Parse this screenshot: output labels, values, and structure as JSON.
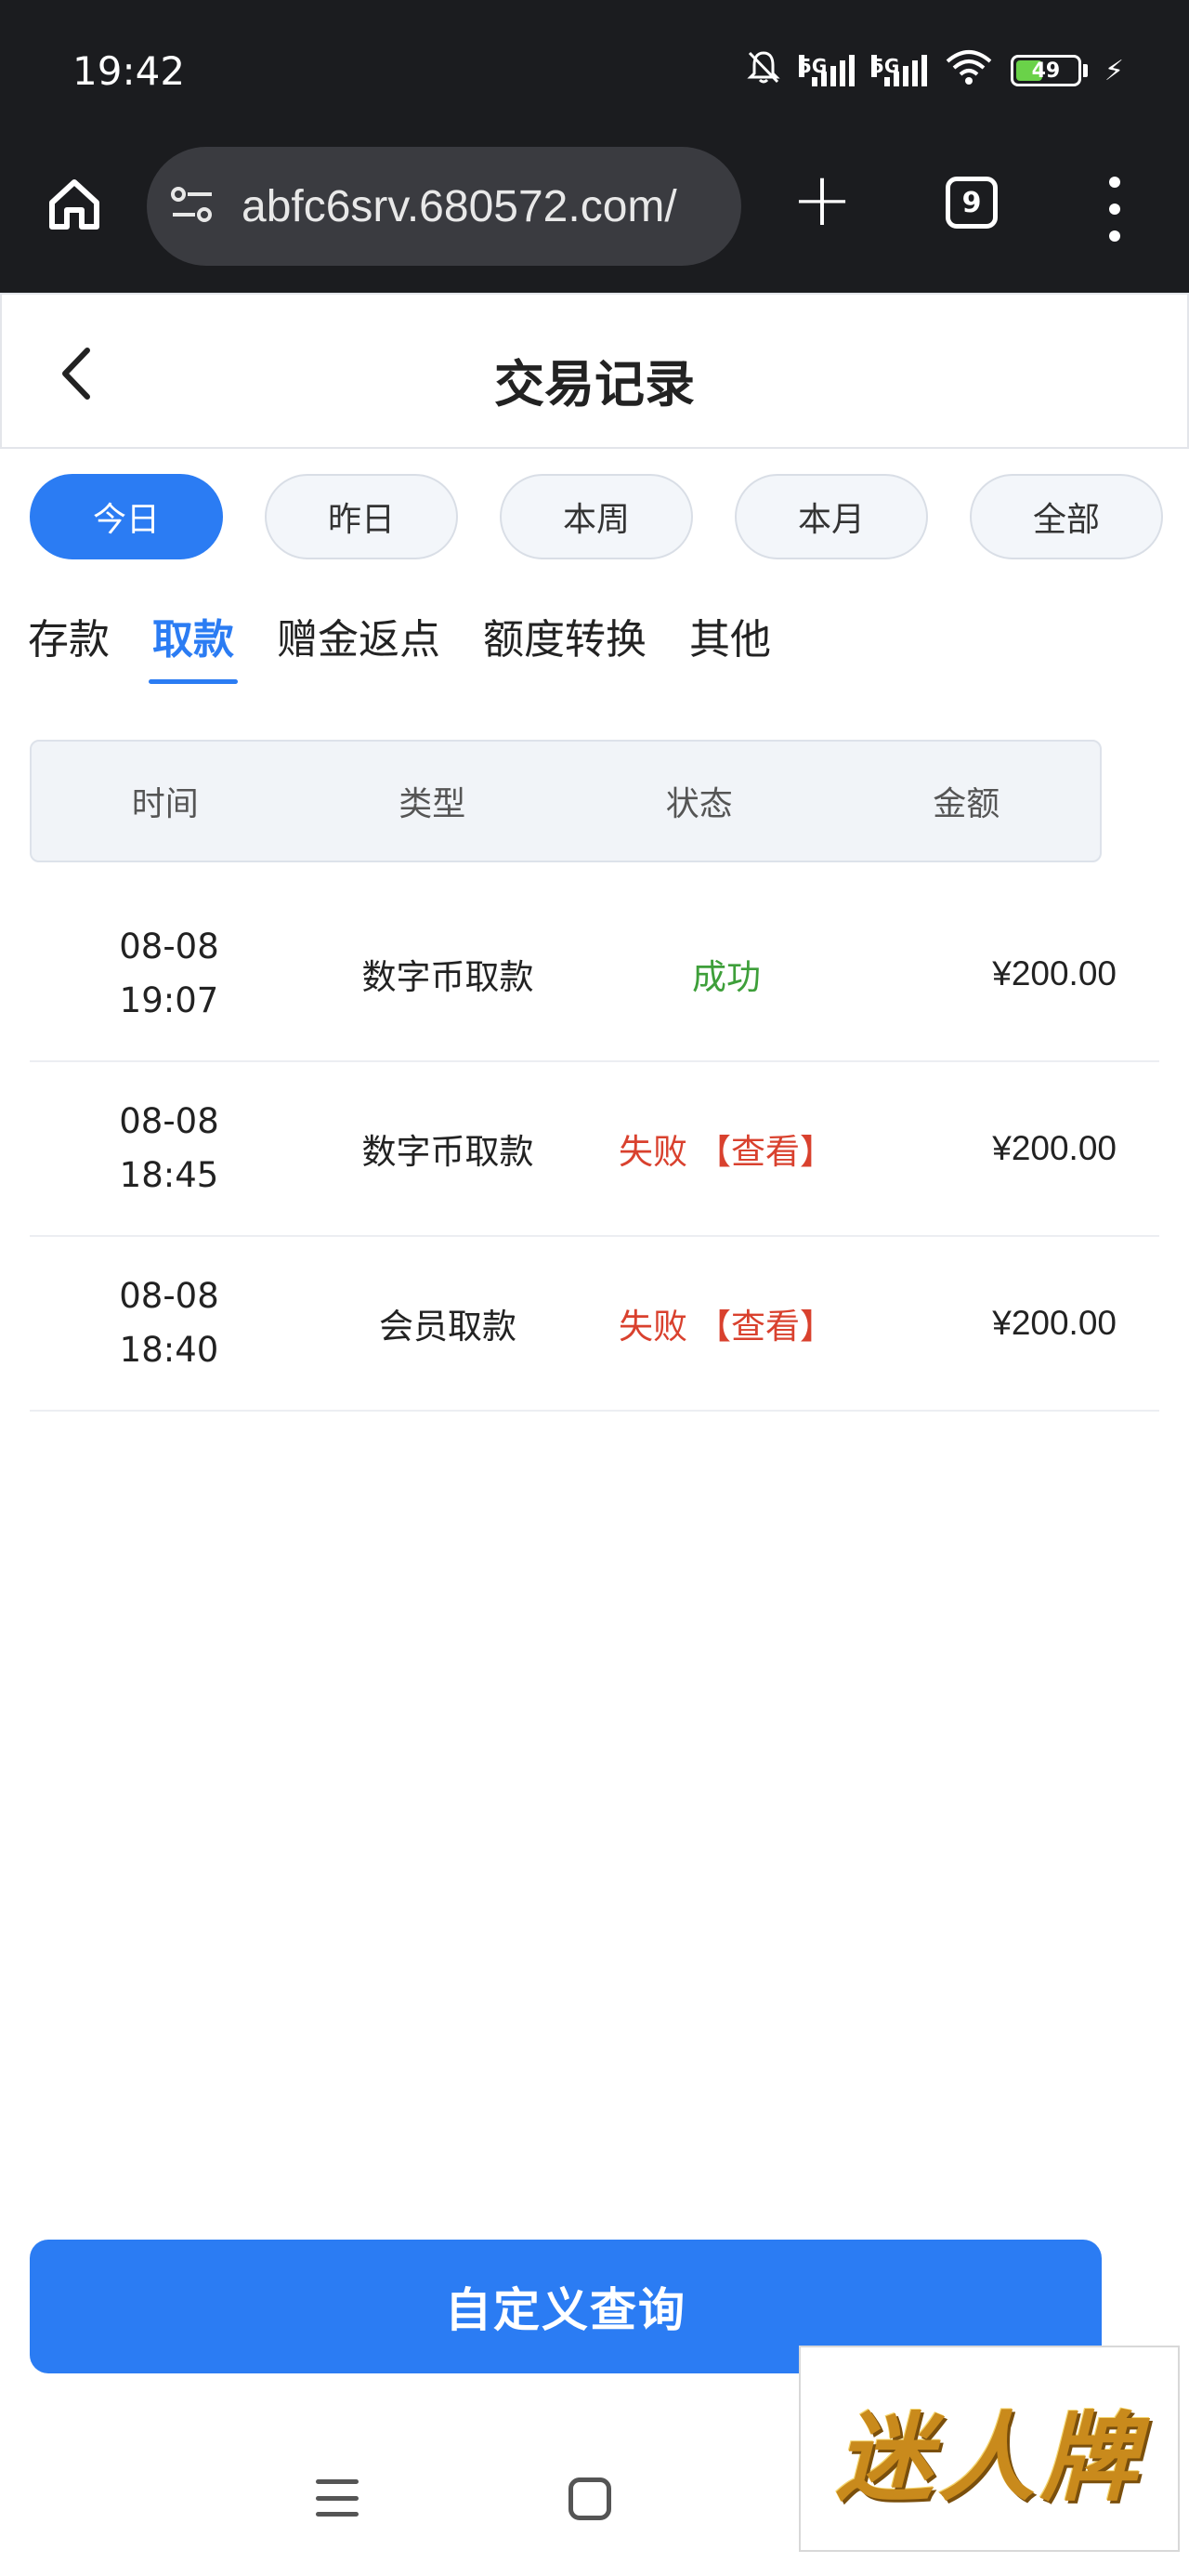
{
  "status_bar": {
    "time": "19:42",
    "signal1_label": "5G",
    "signal2_label": "5G",
    "battery": "49",
    "icons": [
      "mute-bell-icon",
      "signal-icon",
      "signal-icon",
      "wifi-icon",
      "battery-icon",
      "charging-bolt-icon"
    ]
  },
  "browser": {
    "url": "abfc6srv.680572.com/",
    "tab_count": "9",
    "plus_label": "+"
  },
  "header": {
    "title": "交易记录"
  },
  "periods": [
    {
      "label": "今日",
      "active": true
    },
    {
      "label": "昨日",
      "active": false
    },
    {
      "label": "本周",
      "active": false
    },
    {
      "label": "本月",
      "active": false
    },
    {
      "label": "全部",
      "active": false
    }
  ],
  "categories": [
    {
      "label": "存款",
      "active": false
    },
    {
      "label": "取款",
      "active": true
    },
    {
      "label": "赠金返点",
      "active": false
    },
    {
      "label": "额度转换",
      "active": false
    },
    {
      "label": "其他",
      "active": false
    }
  ],
  "table": {
    "headers": [
      "时间",
      "类型",
      "状态",
      "金额"
    ],
    "rows": [
      {
        "date": "08-08",
        "time": "19:07",
        "type": "数字币取款",
        "status": "成功",
        "link": "",
        "amount": "¥200.00"
      },
      {
        "date": "08-08",
        "time": "18:45",
        "type": "数字币取款",
        "status": "失败",
        "link": "【查看】",
        "amount": "¥200.00"
      },
      {
        "date": "08-08",
        "time": "18:40",
        "type": "会员取款",
        "status": "失败",
        "link": "【查看】",
        "amount": "¥200.00"
      }
    ]
  },
  "actions": {
    "custom_query": "自定义查询"
  },
  "watermark": {
    "text": "迷人牌"
  },
  "colors": {
    "accent": "#2b7cf3",
    "success": "#3e9f3a",
    "fail": "#d9412e"
  }
}
